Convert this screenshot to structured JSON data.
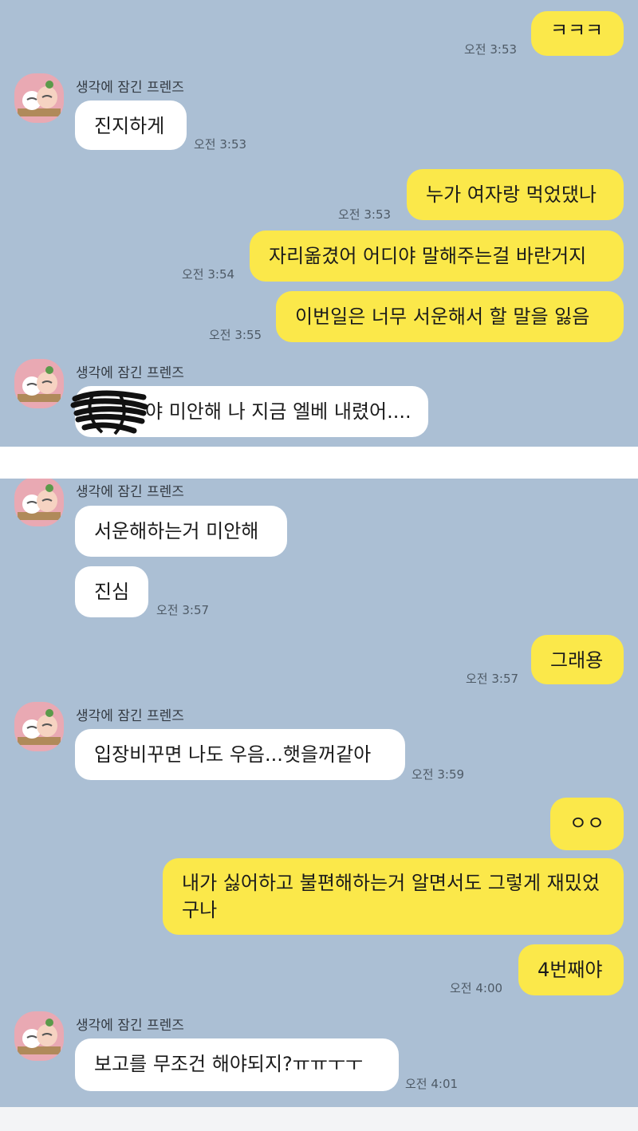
{
  "sender_name": "생각에 잠긴 프렌즈",
  "panel1": {
    "m1": {
      "text": "ㅋㅋㅋ",
      "time": "오전 3:53"
    },
    "m2": {
      "text": "진지하게",
      "time": "오전 3:53"
    },
    "m3": {
      "text": "누가 여자랑 먹었댔나",
      "time": "오전 3:53"
    },
    "m4": {
      "text": "자리옮겼어 어디야 말해주는걸 바란거지",
      "time": "오전 3:54"
    },
    "m5": {
      "text": "이번일은 너무 서운해서 할 말을 잃음",
      "time": "오전 3:55"
    },
    "m6": {
      "text": "야 미안해 나 지금 엘베 내렸어...."
    }
  },
  "panel2": {
    "m1": {
      "text": "서운해하는거 미안해"
    },
    "m2": {
      "text": "진심",
      "time": "오전 3:57"
    },
    "m3": {
      "text": "그래용",
      "time": "오전 3:57"
    },
    "m4": {
      "text": "입장비꾸면 나도 우음...햇을꺼같아",
      "time": "오전 3:59"
    },
    "m5": {
      "text": "ㅇㅇ"
    },
    "m6": {
      "text": "내가 싫어하고 불편해하는거 알면서도 그렇게 재밌었구나"
    },
    "m7": {
      "text": "4번째야",
      "time": "오전 4:00"
    },
    "m8": {
      "text": "보고를 무조건 해야되지?ㅠㅠㅜㅜ",
      "time": "오전 4:01"
    }
  },
  "colors": {
    "chat_background": "#abbfd4",
    "my_bubble": "#fbe84a",
    "friend_bubble": "#ffffff"
  },
  "icons": {
    "avatar": "thinking-friends-avatar-icon",
    "redaction": "scribble-redaction"
  }
}
